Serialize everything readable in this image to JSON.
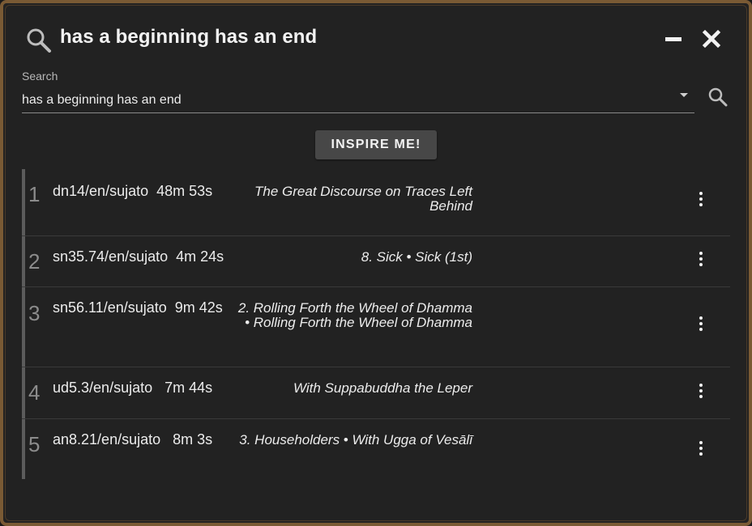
{
  "header": {
    "title": "has a beginning has an end"
  },
  "search": {
    "label": "Search",
    "value": "has a beginning has an end"
  },
  "inspire_label": "INSPIRE ME!",
  "results": [
    {
      "num": "1",
      "ref": "dn14/en/sujato  48m 53s",
      "title": "The Great Discourse on Traces Left Behind"
    },
    {
      "num": "2",
      "ref": "sn35.74/en/sujato  4m 24s",
      "title": "8. Sick • Sick (1st)"
    },
    {
      "num": "3",
      "ref": "sn56.11/en/sujato  9m 42s",
      "title": "2. Rolling Forth the Wheel of Dhamma • Rolling Forth the Wheel of Dhamma"
    },
    {
      "num": "4",
      "ref": "ud5.3/en/sujato   7m 44s",
      "title": "With Suppabuddha the Leper"
    },
    {
      "num": "5",
      "ref": "an8.21/en/sujato   8m 3s",
      "title": "3. Householders • With Ugga of Vesālī"
    }
  ],
  "colors": {
    "frame_border": "#7a5a34",
    "background": "#222222",
    "button_bg": "#474747"
  }
}
